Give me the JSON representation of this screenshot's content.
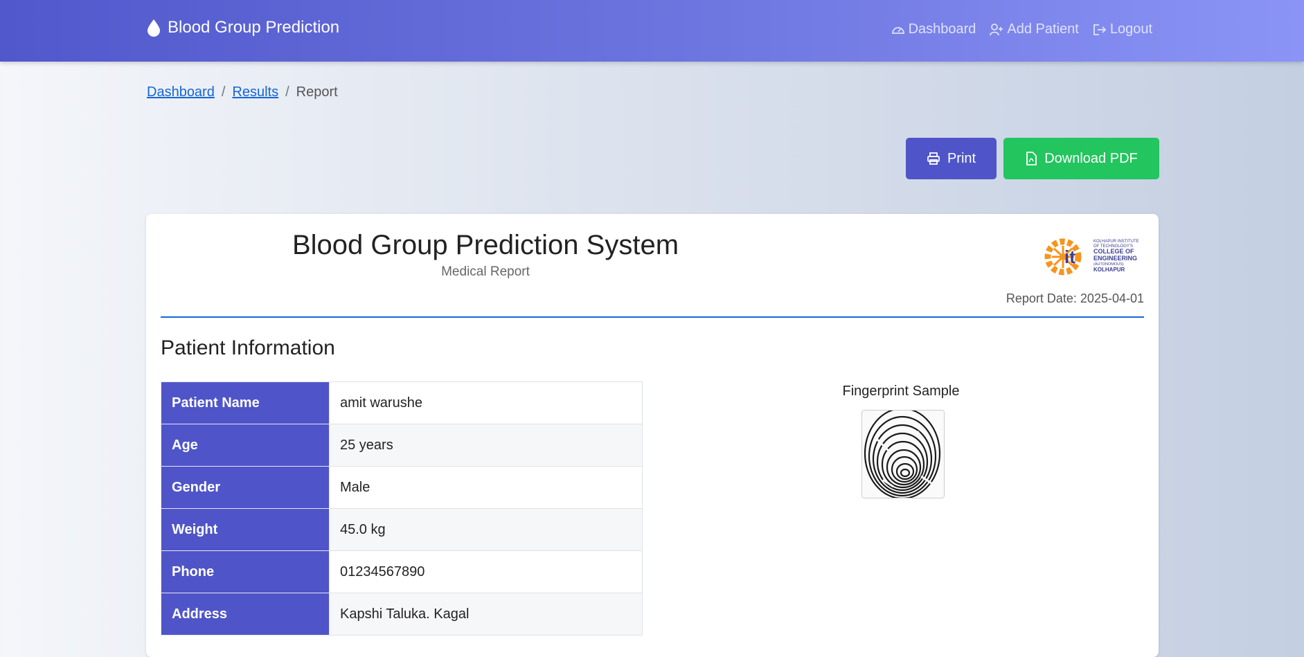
{
  "navbar": {
    "brand": "Blood Group Prediction",
    "links": [
      {
        "label": "Dashboard",
        "icon": "gauge-icon"
      },
      {
        "label": "Add Patient",
        "icon": "user-plus-icon"
      },
      {
        "label": "Logout",
        "icon": "logout-icon"
      }
    ]
  },
  "breadcrumb": {
    "items": [
      "Dashboard",
      "Results"
    ],
    "separator": "/",
    "current": "Report"
  },
  "actions": {
    "print_label": "Print",
    "pdf_label": "Download PDF"
  },
  "report": {
    "title": "Blood Group Prediction System",
    "subtitle": "Medical Report",
    "date": "Report Date: 2025-04-01",
    "logo_lines": [
      "KOLHAPUR INSTITUTE",
      "OF TECHNOLOGY'S",
      "COLLEGE OF",
      "ENGINEERING",
      "(AUTONOMOUS)",
      "KOLHAPUR"
    ]
  },
  "patient": {
    "section_title": "Patient Information",
    "rows": [
      {
        "label": "Patient Name",
        "value": "amit warushe"
      },
      {
        "label": "Age",
        "value": "25 years"
      },
      {
        "label": "Gender",
        "value": "Male"
      },
      {
        "label": "Weight",
        "value": "45.0 kg"
      },
      {
        "label": "Phone",
        "value": "01234567890"
      },
      {
        "label": "Address",
        "value": "Kapshi Taluka. Kagal"
      }
    ]
  },
  "fingerprint": {
    "label": "Fingerprint Sample"
  },
  "colors": {
    "nav_start": "#5058cc",
    "nav_end": "#8b94f6",
    "accent": "#4f55c8",
    "success": "#22c55e",
    "link": "#1565d8",
    "logo_orange": "#f7941d",
    "logo_navy": "#3b3f8f"
  }
}
